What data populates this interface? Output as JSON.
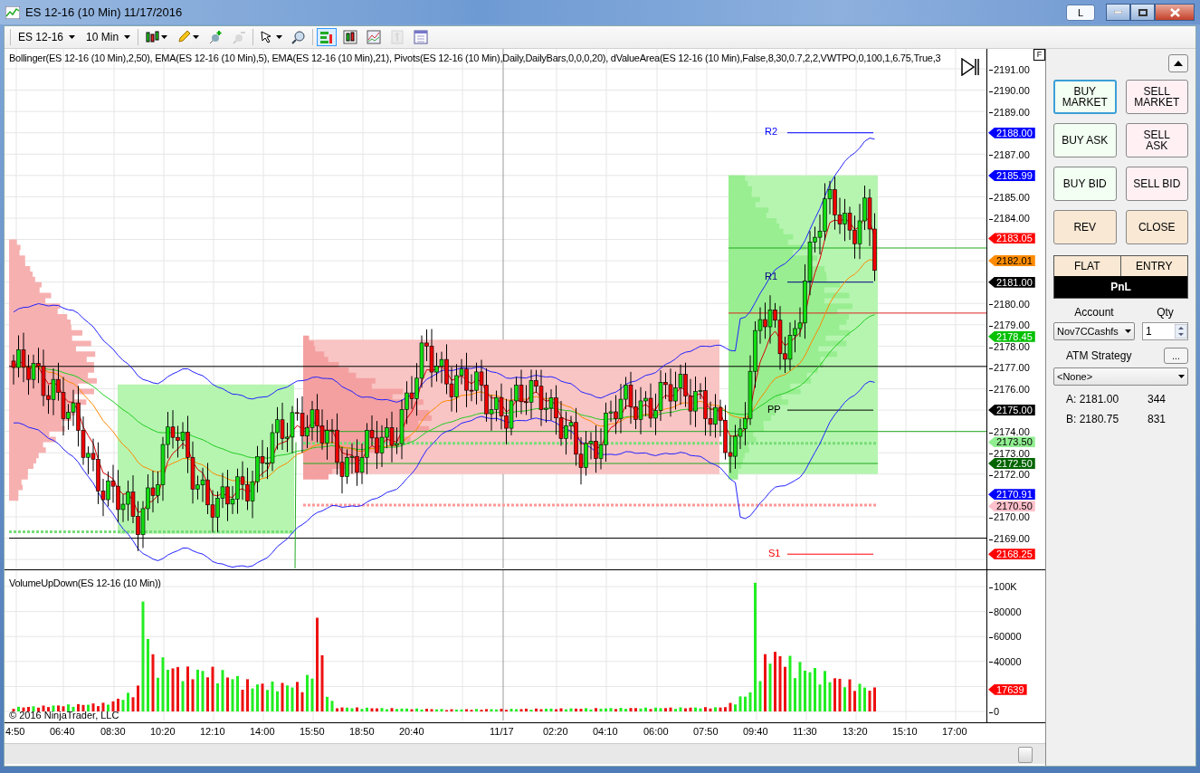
{
  "window": {
    "title": "ES 12-16 (10 Min)  11/17/2016",
    "link_button": "L"
  },
  "toolbar": {
    "instrument": "ES 12-16",
    "interval": "10 Min",
    "tools": [
      {
        "kind": "bar-type",
        "selected": false,
        "disabled": false
      },
      {
        "kind": "draw",
        "selected": false,
        "disabled": false
      },
      {
        "kind": "add-marker",
        "selected": false,
        "disabled": false
      },
      {
        "kind": "remove-marker",
        "selected": false,
        "disabled": true
      },
      {
        "kind": "cursor",
        "selected": false,
        "disabled": false
      },
      {
        "kind": "zoom",
        "selected": false,
        "disabled": false
      },
      {
        "kind": "data-box",
        "selected": true,
        "disabled": false
      },
      {
        "kind": "bars",
        "selected": false,
        "disabled": false
      },
      {
        "kind": "indicators",
        "selected": false,
        "disabled": false
      },
      {
        "kind": "strategy",
        "selected": false,
        "disabled": true
      },
      {
        "kind": "properties",
        "selected": false,
        "disabled": false
      }
    ]
  },
  "price_pane": {
    "indicator_label": "Bollinger(ES 12-16 (10 Min),2,50), EMA(ES 12-16 (10 Min),5), EMA(ES 12-16 (10 Min),21), Pivots(ES 12-16 (10 Min),Daily,DailyBars,0,0,0,20), dValueArea(ES 12-16 (10 Min),False,8,30,0.7,2,2,VWTPO,0,100,1,6.75,True,3",
    "corner_button": "F",
    "axis_ticks": [
      "2191.00",
      "2190.00",
      "2189.00",
      "2187.00",
      "2185.00",
      "2184.00",
      "2180.00",
      "2179.00",
      "2178.00",
      "2177.00",
      "2176.00",
      "2174.00",
      "2173.00",
      "2172.00",
      "2170.00",
      "2169.00"
    ],
    "price_markers": [
      {
        "text": "2188.00",
        "color": "#0000ff"
      },
      {
        "text": "2185.99",
        "color": "#0000ff"
      },
      {
        "text": "2183.05",
        "color": "#ff0000"
      },
      {
        "text": "2182.01",
        "color": "#ff8c00"
      },
      {
        "text": "2181.00",
        "color": "#000000"
      },
      {
        "text": "2178.45",
        "color": "#00c000"
      },
      {
        "text": "2175.00",
        "color": "#000000"
      },
      {
        "text": "2173.50",
        "color": "#90ee90"
      },
      {
        "text": "2172.50",
        "color": "#006400"
      },
      {
        "text": "2170.91",
        "color": "#0000ff"
      },
      {
        "text": "2170.50",
        "color": "#ffc0cb"
      },
      {
        "text": "2168.25",
        "color": "#ff0000"
      }
    ],
    "pivots": [
      {
        "label": "R2",
        "color": "#0000ff"
      },
      {
        "label": "R1",
        "color": "#000080"
      },
      {
        "label": "PP",
        "color": "#000000"
      },
      {
        "label": "S1",
        "color": "#ff0000"
      }
    ]
  },
  "volume_pane": {
    "indicator_label": "VolumeUpDown(ES 12-16 (10 Min))",
    "axis_ticks": [
      "100K",
      "80000",
      "60000",
      "40000",
      "0"
    ],
    "marker": {
      "text": "17639",
      "color": "#ff0000"
    },
    "copyright": "© 2016 NinjaTrader, LLC"
  },
  "time_axis": [
    "4:50",
    "06:40",
    "08:30",
    "10:20",
    "12:10",
    "14:00",
    "15:50",
    "18:50",
    "20:40",
    "11/17",
    "02:20",
    "04:10",
    "06:00",
    "07:50",
    "09:40",
    "11:30",
    "13:20",
    "15:10",
    "17:00"
  ],
  "order_panel": {
    "buttons": [
      {
        "label": "BUY MARKET",
        "kind": "buy",
        "focused": true
      },
      {
        "label": "SELL MARKET",
        "kind": "sell",
        "focused": false
      },
      {
        "label": "BUY ASK",
        "kind": "buy",
        "focused": false
      },
      {
        "label": "SELL ASK",
        "kind": "sell",
        "focused": false
      },
      {
        "label": "BUY BID",
        "kind": "buy",
        "focused": false
      },
      {
        "label": "SELL BID",
        "kind": "sell",
        "focused": false
      },
      {
        "label": "REV",
        "kind": "neutral",
        "focused": false
      },
      {
        "label": "CLOSE",
        "kind": "neutral",
        "focused": false
      }
    ],
    "position": "FLAT",
    "entry": "ENTRY",
    "pnl": "PnL",
    "account_label": "Account",
    "account": "Nov7CCashfs",
    "qty_label": "Qty",
    "qty": "1",
    "atm_label": "ATM Strategy",
    "atm_button": "...",
    "atm_strategy": "<None>",
    "quotes": [
      {
        "label": "A: 2181.00",
        "size": "344"
      },
      {
        "label": "B: 2180.75",
        "size": "831"
      }
    ]
  }
}
